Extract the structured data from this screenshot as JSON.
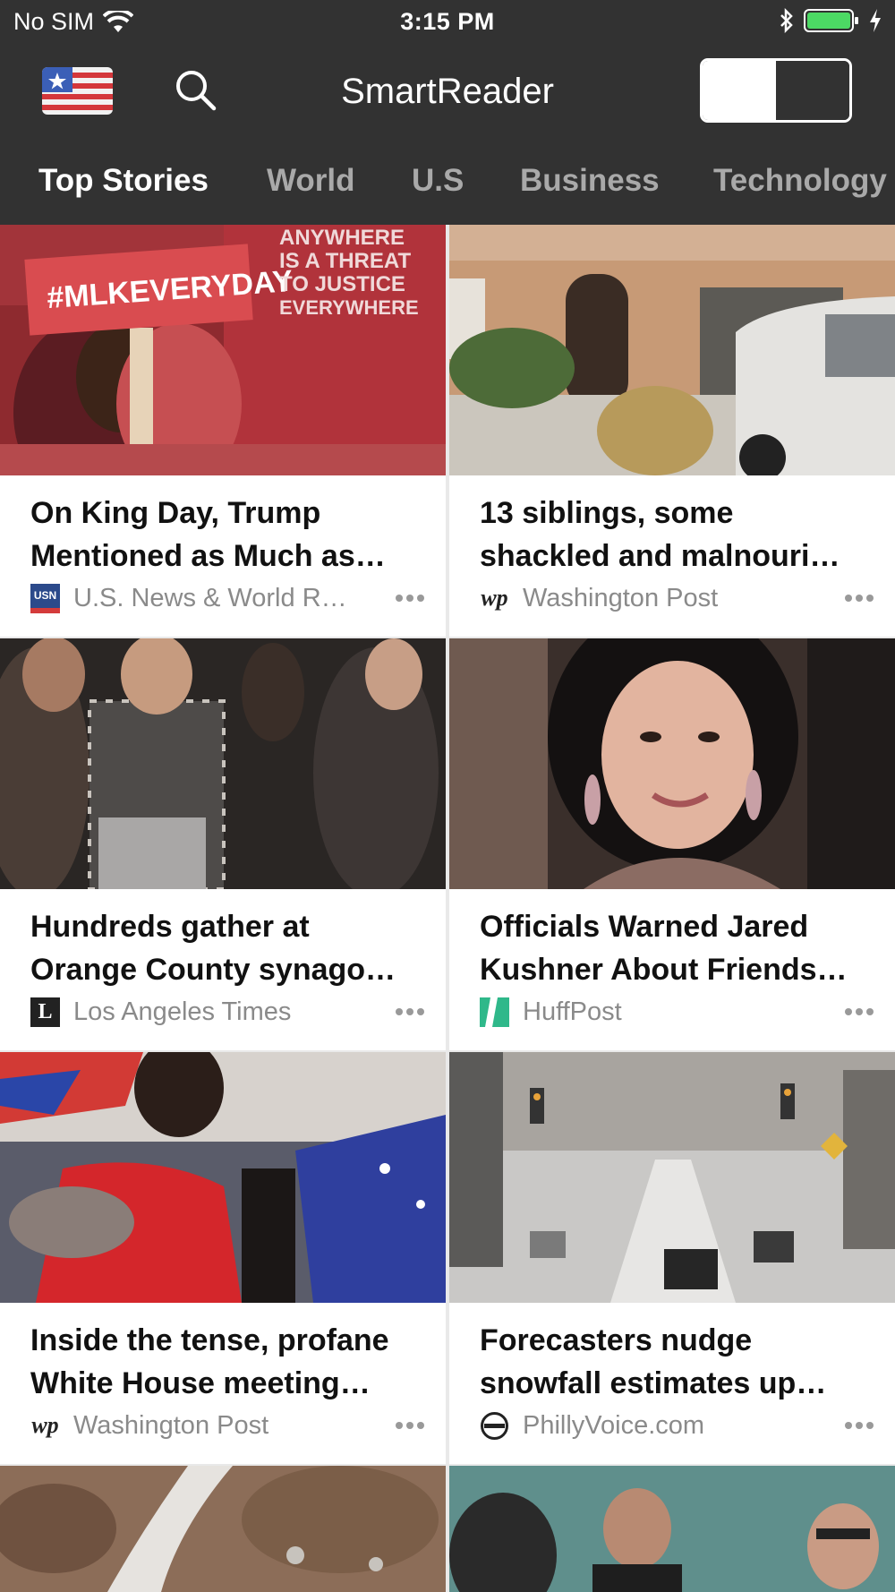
{
  "status_bar": {
    "carrier": "No SIM",
    "time": "3:15 PM"
  },
  "app": {
    "title": "SmartReader",
    "region_icon": "us-flag-icon",
    "search_icon": "search-icon"
  },
  "tabs": [
    {
      "label": "Top Stories",
      "active": true
    },
    {
      "label": "World",
      "active": false
    },
    {
      "label": "U.S",
      "active": false
    },
    {
      "label": "Business",
      "active": false
    },
    {
      "label": "Technology",
      "active": false
    }
  ],
  "colors": {
    "chrome": "#323232",
    "active_tab": "#ffffff",
    "inactive_tab": "#a9a9a9",
    "source_text": "#8a8a8a",
    "battery": "#4cd964"
  },
  "articles": [
    {
      "headline_line1": "On King Day, Trump",
      "headline_line2": "Mentioned as Much as…",
      "source": "U.S. News & World R…",
      "source_logo": "usn-logo",
      "logo_text": "USN"
    },
    {
      "headline_line1": "13 siblings, some",
      "headline_line2": "shackled and malnouri…",
      "source": "Washington Post",
      "source_logo": "wp-logo",
      "logo_text": "wp"
    },
    {
      "headline_line1": "Hundreds gather at",
      "headline_line2": "Orange County synago…",
      "source": "Los Angeles Times",
      "source_logo": "lat-logo",
      "logo_text": "L"
    },
    {
      "headline_line1": "Officials Warned Jared",
      "headline_line2": "Kushner About Friends…",
      "source": "HuffPost",
      "source_logo": "huffpost-logo",
      "logo_text": ""
    },
    {
      "headline_line1": "Inside the tense, profane",
      "headline_line2": "White House meeting…",
      "source": "Washington Post",
      "source_logo": "wp-logo",
      "logo_text": "wp"
    },
    {
      "headline_line1": "Forecasters nudge",
      "headline_line2": "snowfall estimates up…",
      "source": "PhillyVoice.com",
      "source_logo": "phillyvoice-logo",
      "logo_text": ""
    }
  ],
  "photo_text": {
    "sign": "#MLKEVERYDAY",
    "shirt_line1": "ANYWHERE",
    "shirt_line2": "IS A THREAT",
    "shirt_line3": "TO JUSTICE",
    "shirt_line4": "EVERYWHERE"
  }
}
